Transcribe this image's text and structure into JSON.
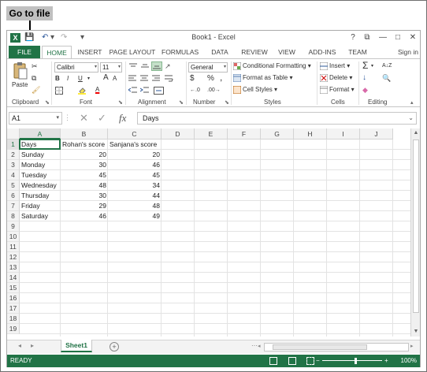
{
  "callout": {
    "text": "Go to file"
  },
  "window": {
    "title": "Book1 - Excel",
    "app_icon": "X",
    "help": "?",
    "restore_ribbon": "⧉",
    "minimize": "—",
    "maximize": "□",
    "close": "✕"
  },
  "qat": {
    "save": "💾",
    "undo": "↶",
    "undo_dd": "▾",
    "redo": "↷",
    "customize": "▾"
  },
  "tabs": [
    "FILE",
    "HOME",
    "INSERT",
    "PAGE LAYOUT",
    "FORMULAS",
    "DATA",
    "REVIEW",
    "VIEW",
    "ADD-INS",
    "TEAM"
  ],
  "signin": "Sign in",
  "ribbon": {
    "clipboard": {
      "label": "Clipboard",
      "paste": "Paste"
    },
    "font": {
      "label": "Font",
      "name": "Calibri",
      "size": "11",
      "bold": "B",
      "italic": "I",
      "underline": "U",
      "grow": "A",
      "shrink": "A"
    },
    "alignment": {
      "label": "Alignment"
    },
    "number": {
      "label": "Number",
      "format": "General",
      "currency": "$",
      "percent": "%",
      "comma": ","
    },
    "styles": {
      "label": "Styles",
      "conditional": "Conditional Formatting",
      "table": "Format as Table",
      "cell_styles": "Cell Styles"
    },
    "cells": {
      "label": "Cells",
      "insert": "Insert",
      "delete": "Delete",
      "format": "Format"
    },
    "editing": {
      "label": "Editing",
      "sum": "Σ",
      "sort": "A↓Z",
      "fill": "↓",
      "find": "🔍",
      "clear": "◆"
    }
  },
  "formula_bar": {
    "name_box": "A1",
    "cancel": "✕",
    "enter": "✓",
    "fx": "fx",
    "content": "Days"
  },
  "grid": {
    "columns": [
      "A",
      "B",
      "C",
      "D",
      "E",
      "F",
      "G",
      "H",
      "I",
      "J"
    ],
    "rows": [
      "1",
      "2",
      "3",
      "4",
      "5",
      "6",
      "7",
      "8",
      "9",
      "10",
      "11",
      "12",
      "13",
      "14",
      "15",
      "16",
      "17",
      "18",
      "19"
    ],
    "data": [
      [
        "Days",
        "Rohan's score",
        "Sanjana's score"
      ],
      [
        "Sunday",
        "20",
        "20"
      ],
      [
        "Monday",
        "30",
        "46"
      ],
      [
        "Tuesday",
        "45",
        "45"
      ],
      [
        "Wednesday",
        "48",
        "34"
      ],
      [
        "Thursday",
        "30",
        "44"
      ],
      [
        "Friday",
        "29",
        "48"
      ],
      [
        "Saturday",
        "46",
        "49"
      ]
    ]
  },
  "sheets": {
    "active": "Sheet1",
    "add": "+",
    "prev": "◂",
    "next": "▸",
    "more": "⋯"
  },
  "status": {
    "text": "READY",
    "zoom": "100%",
    "zoom_minus": "−",
    "zoom_plus": "+"
  },
  "colors": {
    "excel_green": "#217346",
    "header_bg": "#f3f3f3",
    "gridline": "#e3e3e3"
  }
}
